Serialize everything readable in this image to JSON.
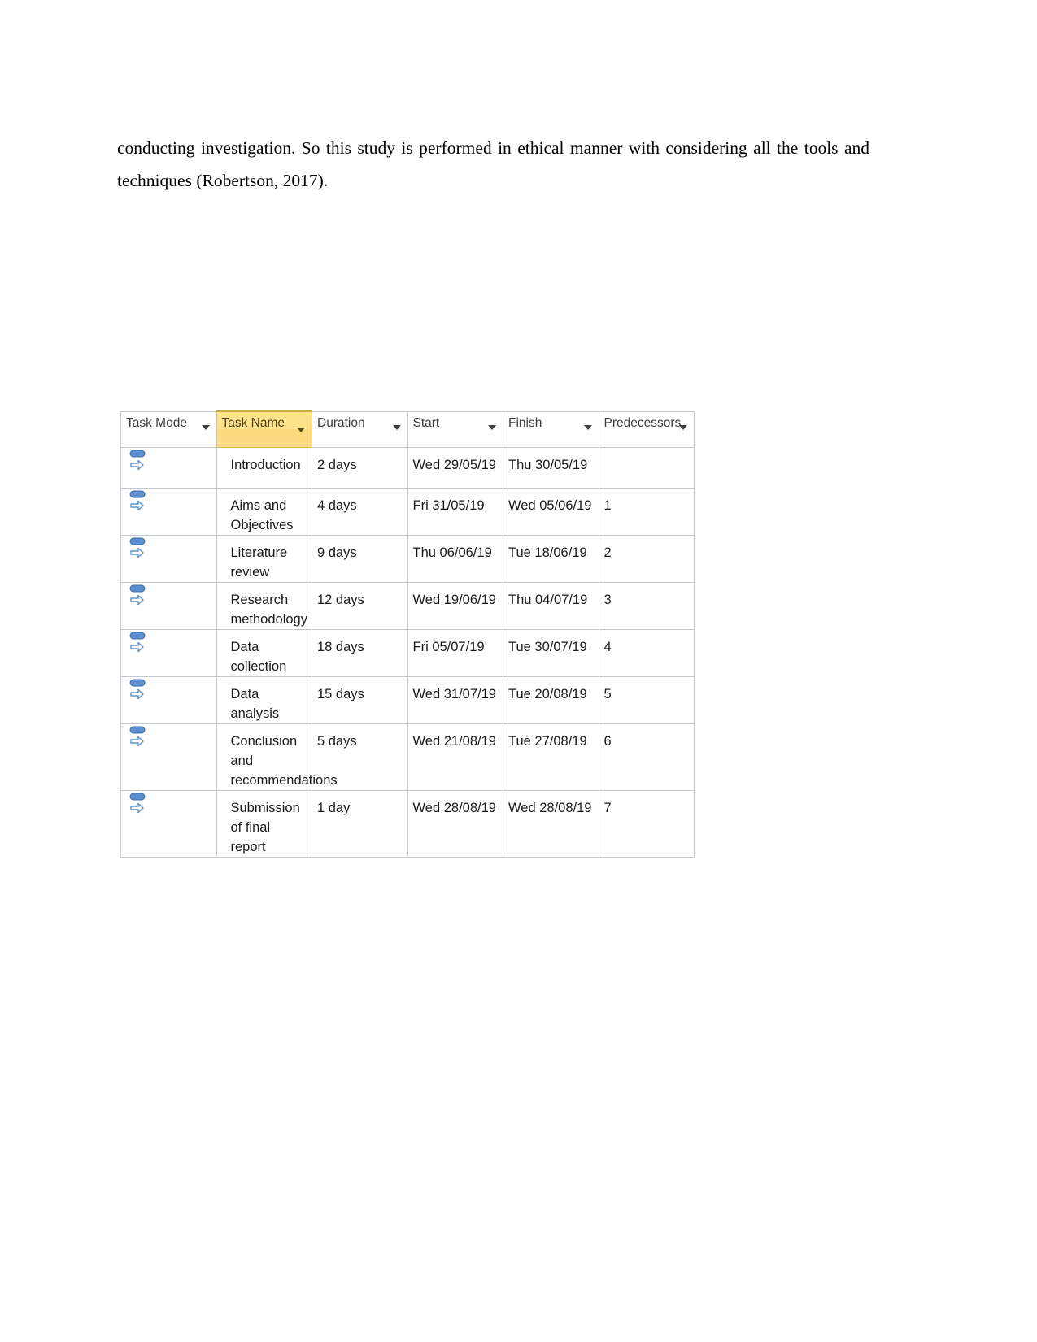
{
  "document": {
    "paragraph": "conducting investigation. So this study is performed in ethical manner with considering all the tools and techniques  (Robertson,  2017)."
  },
  "task_table": {
    "columns": [
      {
        "label": "Task Mode",
        "name": "task-mode",
        "accent": false,
        "has_filter": true
      },
      {
        "label": "Task Name",
        "name": "task-name",
        "accent": true,
        "has_filter": true
      },
      {
        "label": "Duration",
        "name": "duration",
        "accent": false,
        "has_filter": true
      },
      {
        "label": "Start",
        "name": "start",
        "accent": false,
        "has_filter": true
      },
      {
        "label": "Finish",
        "name": "finish",
        "accent": false,
        "has_filter": true
      },
      {
        "label": "Predecessors",
        "name": "predecessors",
        "accent": false,
        "has_filter": true
      }
    ],
    "rows": [
      {
        "mode_icon": "manually-scheduled-icon",
        "task_name": "Introduction",
        "duration": "2 days",
        "start": "Wed 29/05/19",
        "finish": "Thu 30/05/19",
        "predecessors": ""
      },
      {
        "mode_icon": "manually-scheduled-icon",
        "task_name": "Aims and Objectives",
        "duration": "4 days",
        "start": "Fri 31/05/19",
        "finish": "Wed 05/06/19",
        "predecessors": "1"
      },
      {
        "mode_icon": "manually-scheduled-icon",
        "task_name": "Literature review",
        "duration": "9 days",
        "start": "Thu 06/06/19",
        "finish": "Tue 18/06/19",
        "predecessors": "2"
      },
      {
        "mode_icon": "manually-scheduled-icon",
        "task_name": "Research methodology",
        "duration": "12 days",
        "start": "Wed 19/06/19",
        "finish": "Thu 04/07/19",
        "predecessors": "3"
      },
      {
        "mode_icon": "manually-scheduled-icon",
        "task_name": "Data collection",
        "duration": "18 days",
        "start": "Fri 05/07/19",
        "finish": "Tue 30/07/19",
        "predecessors": "4"
      },
      {
        "mode_icon": "manually-scheduled-icon",
        "task_name": "Data analysis",
        "duration": "15 days",
        "start": "Wed 31/07/19",
        "finish": "Tue 20/08/19",
        "predecessors": "5"
      },
      {
        "mode_icon": "manually-scheduled-icon",
        "task_name": "Conclusion and recommendations",
        "duration": "5 days",
        "start": "Wed 21/08/19",
        "finish": "Tue 27/08/19",
        "predecessors": "6"
      },
      {
        "mode_icon": "manually-scheduled-icon",
        "task_name": "Submission of final report",
        "duration": "1 day",
        "start": "Wed 28/08/19",
        "finish": "Wed 28/08/19",
        "predecessors": "7"
      }
    ]
  },
  "colors": {
    "header_background": "#d7dbe2",
    "header_accent_background": "#fcdd85",
    "grid_line": "#c4c9d0",
    "text": "#1a1a1a",
    "icon_blue": "#5b8fd0"
  }
}
